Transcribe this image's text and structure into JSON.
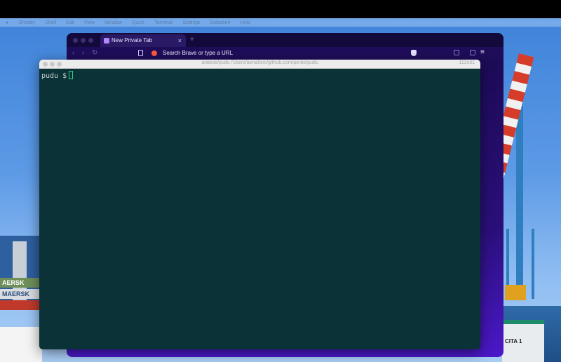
{
  "menubar": {
    "items": [
      "Ghostty",
      "Shell",
      "Edit",
      "View",
      "Window",
      "Quick",
      "Terminal",
      "Settings",
      "Selection",
      "Help"
    ]
  },
  "browser": {
    "tab_title": "New Private Tab",
    "tab_close": "×",
    "new_tab": "+",
    "back": "‹",
    "forward": "›",
    "reload": "↻",
    "url_placeholder": "Search Brave or type a URL",
    "menu": "≡"
  },
  "terminal": {
    "title": "ariatuts/pudu /Users/aerial/src/github.com/perbe/pudu",
    "size": "112x31",
    "prompt": "pudu $"
  },
  "wallpaper": {
    "container_labels": [
      "AERSK",
      "MAERSK"
    ],
    "ship_label": "CITA 1"
  },
  "colors": {
    "terminal_bg": "#0b3337",
    "brave_bg": "#2a0f7a",
    "cursor": "#2fd08a"
  }
}
